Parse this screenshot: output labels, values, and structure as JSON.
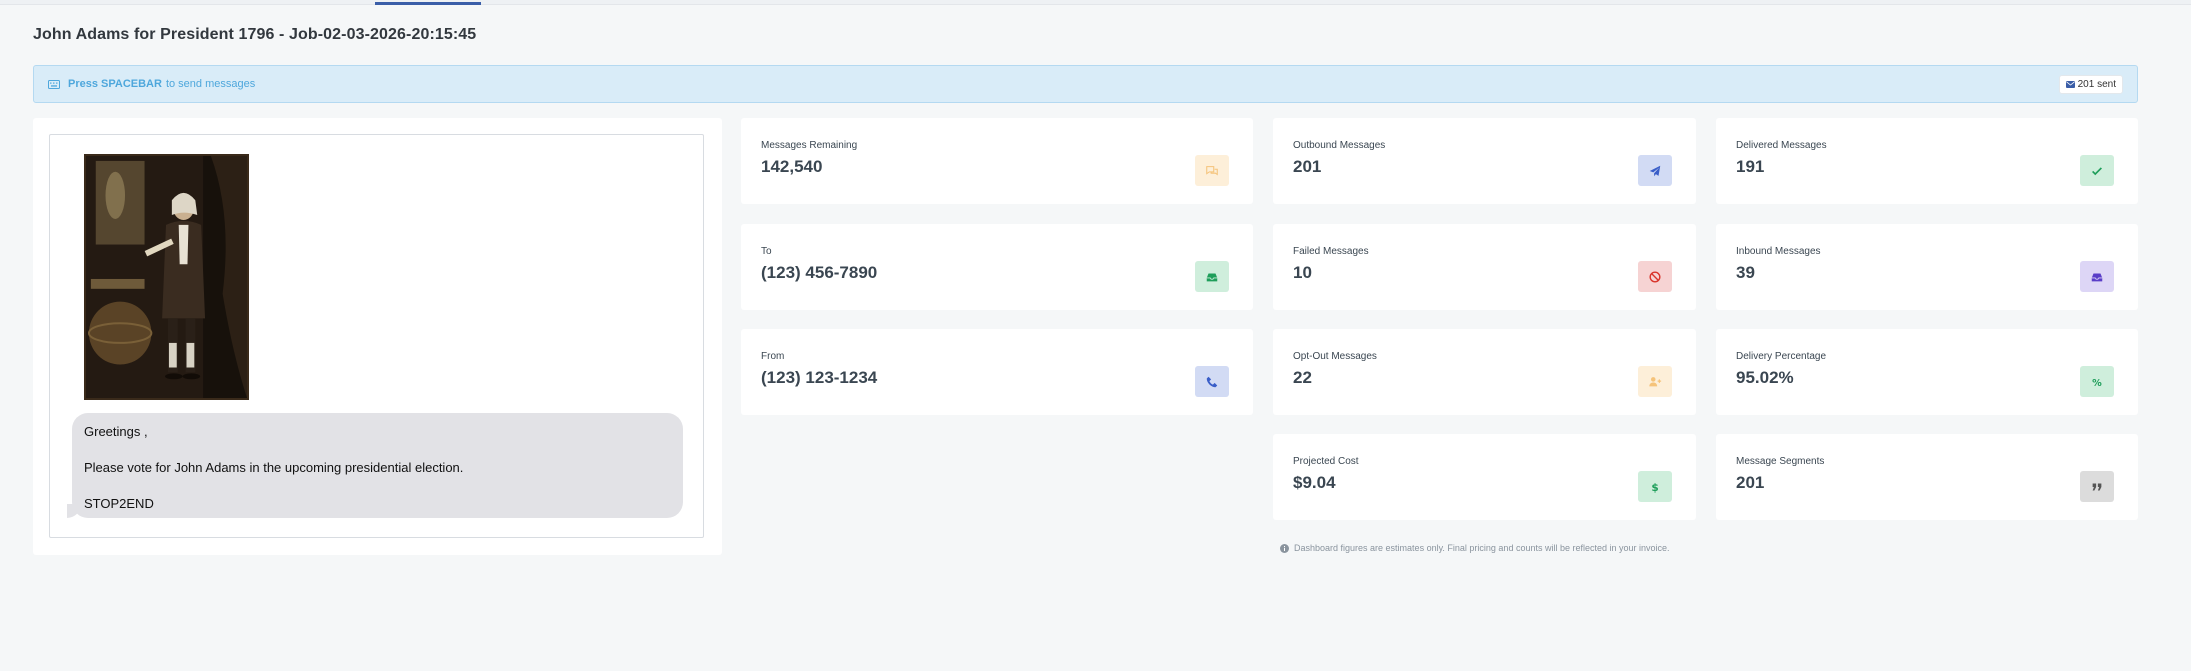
{
  "page": {
    "title": "John Adams for President 1796 - Job-02-03-2026-20:15:45"
  },
  "alert": {
    "key": "Press SPACEBAR",
    "text": "to send messages",
    "sent_badge": "201 sent",
    "icon": "keyboard-icon",
    "color": "#d9ecf8"
  },
  "preview": {
    "image_alt": "Portrait of John Adams",
    "message_lines": [
      "Greetings ,",
      "Please vote for John Adams in the upcoming presidential election.",
      "STOP2END"
    ]
  },
  "stats": {
    "messages_remaining": {
      "label": "Messages Remaining",
      "value": "142,540",
      "icon": "chat-icon",
      "color": "#f5a623"
    },
    "to": {
      "label": "To",
      "value": "(123) 456-7890",
      "icon": "inbox-icon",
      "color": "#1e9e5a"
    },
    "from": {
      "label": "From",
      "value": "(123) 123-1234",
      "icon": "phone-icon",
      "color": "#3a5ec8"
    },
    "outbound": {
      "label": "Outbound Messages",
      "value": "201",
      "icon": "paper-plane-icon",
      "color": "#3a5ec8"
    },
    "failed": {
      "label": "Failed Messages",
      "value": "10",
      "icon": "ban-icon",
      "color": "#d9342b"
    },
    "opt_out": {
      "label": "Opt-Out Messages",
      "value": "22",
      "icon": "user-plus-icon",
      "color": "#f5a623"
    },
    "projected_cost": {
      "label": "Projected Cost",
      "value": "$9.04",
      "icon": "dollar-icon",
      "color": "#1e9e5a"
    },
    "delivered": {
      "label": "Delivered Messages",
      "value": "191",
      "icon": "check-icon",
      "color": "#1e9e5a"
    },
    "inbound": {
      "label": "Inbound Messages",
      "value": "39",
      "icon": "inbox-icon",
      "color": "#5a3ec8"
    },
    "delivery_pct": {
      "label": "Delivery Percentage",
      "value": "95.02%",
      "icon": "percent-icon",
      "color": "#1e9e5a"
    },
    "segments": {
      "label": "Message Segments",
      "value": "201",
      "icon": "quote-icon",
      "color": "#555555"
    }
  },
  "footnote": "Dashboard figures are estimates only. Final pricing and counts will be reflected in your invoice."
}
